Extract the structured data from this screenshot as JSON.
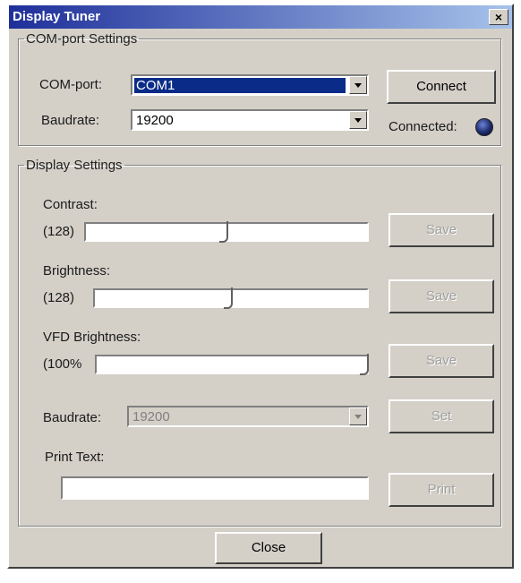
{
  "window": {
    "title": "Display Tuner",
    "close_glyph": "×"
  },
  "com_settings": {
    "legend": "COM-port Settings",
    "com_port_label": "COM-port:",
    "com_port_value": "COM1",
    "baudrate_label": "Baudrate:",
    "baudrate_value": "19200",
    "connect_label": "Connect",
    "connected_label": "Connected:",
    "connected_indicator_color": "#1d2a6a"
  },
  "display_settings": {
    "legend": "Display Settings",
    "contrast": {
      "label": "Contrast:",
      "value_text": "(128)",
      "level": 0.5,
      "save_label": "Save"
    },
    "brightness": {
      "label": "Brightness:",
      "value_text": "(128)",
      "level": 0.5,
      "save_label": "Save"
    },
    "vfd_brightness": {
      "label": "VFD Brightness:",
      "value_text": "(100%",
      "level": 1.0,
      "save_label": "Save"
    },
    "baudrate_label": "Baudrate:",
    "baudrate_value": "19200",
    "set_label": "Set",
    "print_text_label": "Print Text:",
    "print_text_value": "",
    "print_label": "Print"
  },
  "footer": {
    "close_label": "Close"
  }
}
